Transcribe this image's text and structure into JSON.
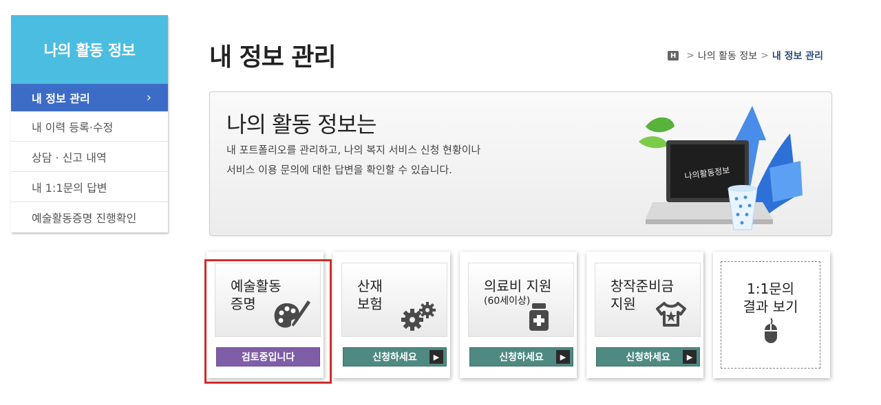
{
  "sidebar": {
    "title": "나의 활동 정보",
    "items": [
      {
        "label": "내 정보 관리",
        "active": true,
        "chevron": "›"
      },
      {
        "label": "내 이력 등록·수정"
      },
      {
        "label": "상담 · 신고 내역"
      },
      {
        "label": "내 1:1문의 답변"
      },
      {
        "label": "예술활동증명 진행확인"
      }
    ]
  },
  "header": {
    "title": "내 정보 관리",
    "breadcrumb": {
      "home": "H",
      "items": [
        "나의 활동 정보",
        "내 정보 관리"
      ],
      "separator": ">"
    }
  },
  "banner": {
    "heading": "나의 활동 정보는",
    "desc_line1": "내 포트폴리오를 관리하고, 나의 복지 서비스 신청 현황이나",
    "desc_line2": "서비스 이용 문의에 대한 답변을 확인할 수 있습니다.",
    "screen_text": "나의활동정보"
  },
  "cards": [
    {
      "title1": "예술활동",
      "title2": "증명",
      "button": "검토중입니다",
      "icon": "palette-icon"
    },
    {
      "title1": "산재",
      "title2": "보험",
      "button": "신청하세요",
      "icon": "gears-icon"
    },
    {
      "title1": "의료비 지원",
      "sub": "(60세이상)",
      "button": "신청하세요",
      "icon": "medicine-bottle-icon"
    },
    {
      "title1": "창작준비금",
      "title2": "지원",
      "button": "신청하세요",
      "icon": "shirt-star-icon"
    },
    {
      "title1": "1:1문의",
      "title2": "결과 보기",
      "icon": "mouse-icon"
    }
  ],
  "colors": {
    "sidebar_title": "#4bbde0",
    "active_item": "#3d6cc6",
    "apply_button": "#4f8a82",
    "review_button": "#7f5ea8",
    "highlight": "#d12b2b"
  }
}
